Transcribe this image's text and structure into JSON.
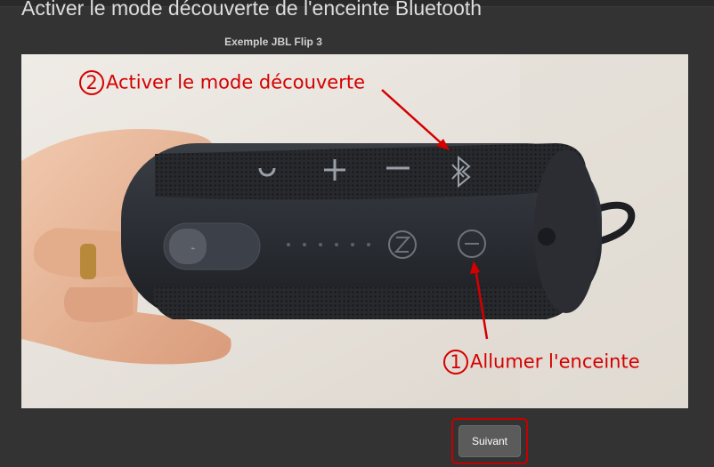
{
  "page": {
    "title": "Activer le mode découverte de l'enceinte Bluetooth",
    "subtitle": "Exemple JBL Flip 3"
  },
  "figure": {
    "step2": {
      "number": "2",
      "label": "Activer le mode découverte"
    },
    "step1": {
      "number": "1",
      "label": "Allumer l'enceinte"
    },
    "annotation_color": "#d40000",
    "icons": [
      "speaker-photo",
      "bluetooth-icon",
      "power-icon",
      "plus-icon",
      "minus-icon",
      "connect-icon",
      "usb-port-icon"
    ]
  },
  "footer": {
    "next_label": "Suivant",
    "highlight_color": "#c40000"
  }
}
